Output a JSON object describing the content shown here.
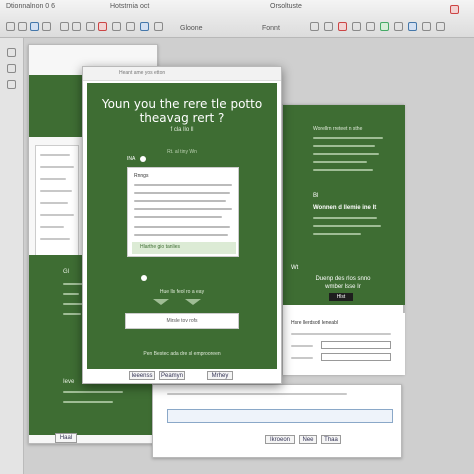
{
  "toolbar": {
    "title_left": "Dtionnalnon 0 6",
    "title_mid": "Hotstrnia oct",
    "title_right": "Orsoltuste",
    "menu_left": "Gloone",
    "menu_right": "Fonnt"
  },
  "dialog": {
    "header_text": "Heant ame yos etton",
    "title": "Youn you the rere tle potto theavag rert ?",
    "subtitle": "f cla llo ll",
    "note": "Rt. al tiny Wn",
    "step1_label": "INA",
    "card_heading": "Rnngs",
    "card_line": "Hlarthe gio tanlies",
    "question": "Hue lls feol ro a eay",
    "input_value": "Mirsle tov rofs",
    "footer_text": "Pen Bestec ada dre sl emprooreen",
    "tabs": [
      "Ieeenss",
      "Peamyn",
      "Mrhey"
    ]
  },
  "right_panel": {
    "heading": "Worellrn rreteet n sthe",
    "step_label": "Bl",
    "subheading": "Wonnen d llemie ine  lt",
    "step2_label": "Wt",
    "callout": "Duenp des rlos snno wmber lsse Ir",
    "callout_button": "Hlst",
    "form_title": "Hsre llerdsotl  Ieneabl"
  },
  "left_panel": {
    "label_a": "Gl",
    "label_b": "Ieve",
    "footer_button": "Haal"
  },
  "bottom_panel": {
    "buttons": [
      "Ikroeon",
      "Nee",
      "Thaa"
    ]
  }
}
